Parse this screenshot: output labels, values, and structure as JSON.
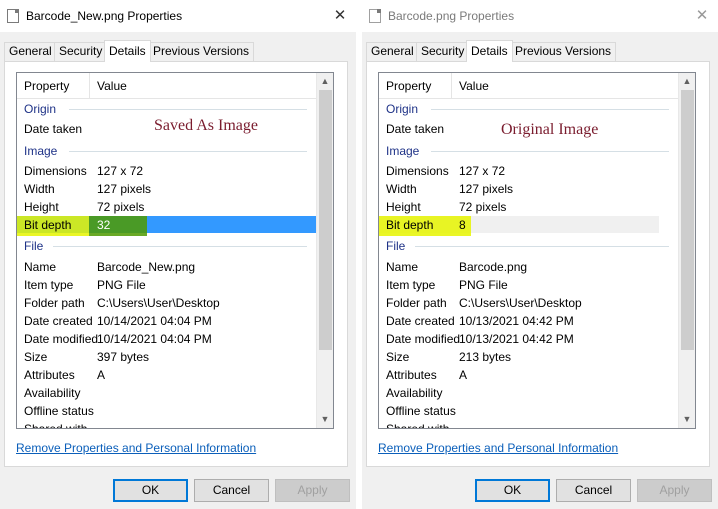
{
  "columns": {
    "property": "Property",
    "value": "Value"
  },
  "groups": {
    "origin": "Origin",
    "image": "Image",
    "file": "File"
  },
  "labels": {
    "date_taken": "Date taken",
    "dimensions": "Dimensions",
    "width": "Width",
    "height": "Height",
    "bit_depth": "Bit depth",
    "name": "Name",
    "item_type": "Item type",
    "folder_path": "Folder path",
    "date_created": "Date created",
    "date_modified": "Date modified",
    "size": "Size",
    "attributes": "Attributes",
    "availability": "Availability",
    "offline_status": "Offline status",
    "shared_with": "Shared with"
  },
  "tabs": {
    "general": "General",
    "security": "Security",
    "details": "Details",
    "previous_versions": "Previous Versions"
  },
  "link_text": "Remove Properties and Personal Information",
  "buttons": {
    "ok": "OK",
    "cancel": "Cancel",
    "apply": "Apply"
  },
  "close_glyph": "✕",
  "scroll_up_glyph": "▲",
  "scroll_down_glyph": "▼",
  "colors": {
    "selection_blue": "#3399ff",
    "highlight_yellow": "#e6f400",
    "annotation": "#7a1c2e",
    "link": "#0b5fba",
    "group_header": "#1e3287"
  },
  "dialogs": [
    {
      "title": "Barcode_New.png Properties",
      "active": true,
      "annotation": "Saved As Image",
      "values": {
        "dimensions": "127 x 72",
        "width": "127 pixels",
        "height": "72 pixels",
        "bit_depth": "32",
        "name": "Barcode_New.png",
        "item_type": "PNG File",
        "folder_path": "C:\\Users\\User\\Desktop",
        "date_created": "10/14/2021 04:04 PM",
        "date_modified": "10/14/2021 04:04 PM",
        "size": "397 bytes",
        "attributes": "A"
      }
    },
    {
      "title": "Barcode.png Properties",
      "active": false,
      "annotation": "Original Image",
      "values": {
        "dimensions": "127 x 72",
        "width": "127 pixels",
        "height": "72 pixels",
        "bit_depth": "8",
        "name": "Barcode.png",
        "item_type": "PNG File",
        "folder_path": "C:\\Users\\User\\Desktop",
        "date_created": "10/13/2021 04:42 PM",
        "date_modified": "10/13/2021 04:42 PM",
        "size": "213 bytes",
        "attributes": "A"
      }
    }
  ]
}
